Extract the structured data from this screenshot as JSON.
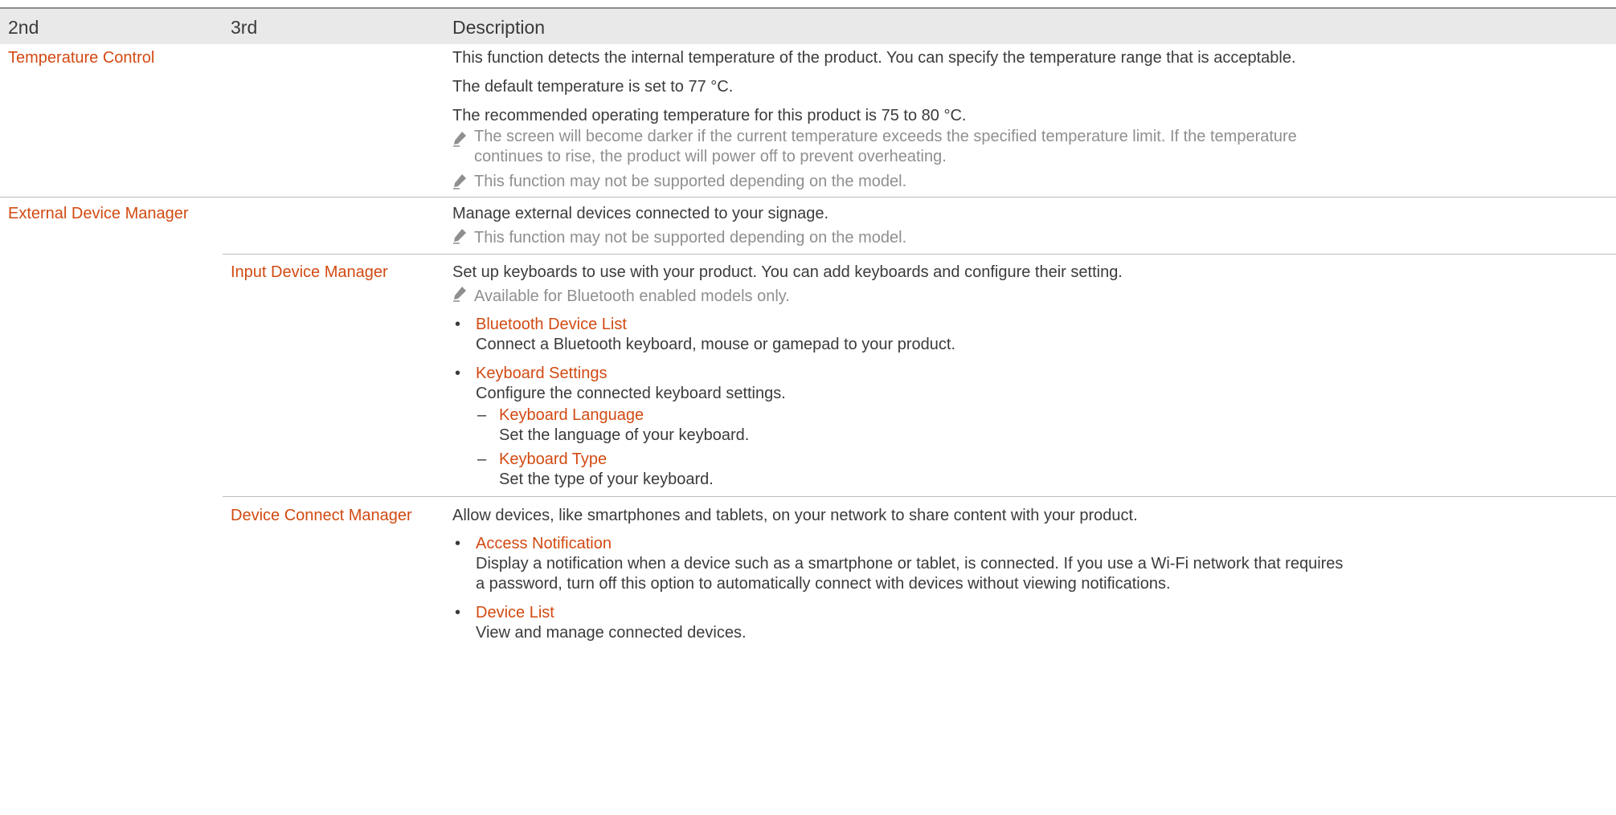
{
  "table": {
    "headers": {
      "col2": "2nd",
      "col3": "3rd",
      "desc": "Description"
    }
  },
  "rows": {
    "temp": {
      "label": "Temperature Control",
      "desc": [
        "This function detects the internal temperature of the product. You can specify the temperature range that is acceptable.",
        "The default temperature is set to 77 °C.",
        "The recommended operating temperature for this product is 75 to 80 °C."
      ],
      "notes": [
        "The screen will become darker if the current temperature exceeds the specified temperature limit. If the temperature",
        "continues to rise, the product will power off to prevent overheating.",
        "This function may not be supported depending on the model."
      ]
    },
    "ext": {
      "label": "External Device Manager",
      "desc": "Manage external devices connected to your signage.",
      "note": "This function may not be supported depending on the model."
    },
    "input": {
      "label": "Input Device Manager",
      "desc": "Set up keyboards to use with your product. You can add keyboards and configure their setting.",
      "note": "Available for Bluetooth enabled models only.",
      "bt_title": "Bluetooth Device List",
      "bt_desc": "Connect a Bluetooth keyboard, mouse or gamepad to your product.",
      "kb_title": "Keyboard Settings",
      "kb_desc": "Configure the connected keyboard settings.",
      "lang_title": "Keyboard Language",
      "lang_desc": "Set the language of your keyboard.",
      "type_title": "Keyboard Type",
      "type_desc": "Set the type of your keyboard."
    },
    "dcm": {
      "label": "Device Connect Manager",
      "desc": "Allow devices, like smartphones and tablets, on your network to share content with your product.",
      "an_title": "Access Notification",
      "an_desc1": "Display a notification when a device such as a smartphone or tablet, is connected. If you use a Wi-Fi network that requires",
      "an_desc2": "a password, turn off this option to automatically connect with devices without viewing notifications.",
      "dl_title": "Device List",
      "dl_desc": "View and manage connected devices."
    }
  },
  "markers": {
    "bullet": "•",
    "dash": "–"
  },
  "colors": {
    "highlight": "#d24a12",
    "header_bg": "#e9e9e9",
    "note": "#8f8f8f",
    "text": "#3b3b3b"
  },
  "icons": {
    "note": "pencil-icon"
  }
}
